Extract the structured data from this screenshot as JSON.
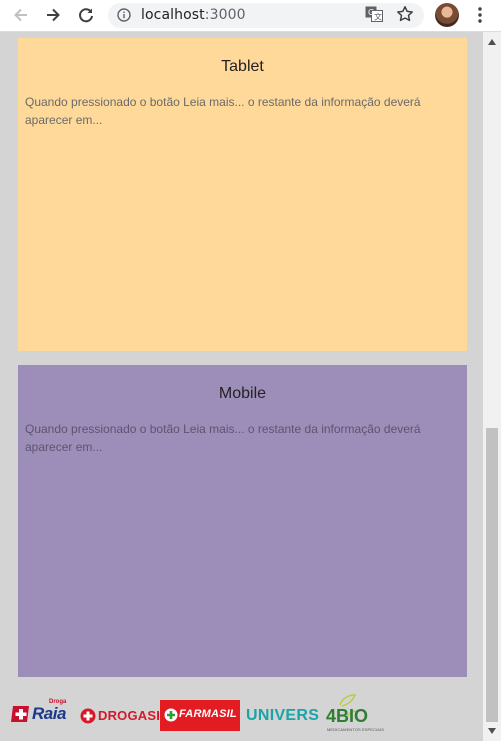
{
  "browser": {
    "url_host": "localhost",
    "url_port": ":3000"
  },
  "cards": [
    {
      "title": "Tablet",
      "text": "Quando pressionado o botão Leia mais... o restante da informação deverá aparecer em..."
    },
    {
      "title": "Mobile",
      "text": "Quando pressionado o botão Leia mais... o restante da informação deverá aparecer em..."
    }
  ],
  "brands": {
    "raia_small": "Droga",
    "raia": "Raia",
    "drogasil": "DROGASIL",
    "farmasil": "FARMASIL",
    "univers": "UNIVERS",
    "bio": "4BIO",
    "bio_sub": "MEDICAMENTOS ESPECIAIS"
  },
  "colors": {
    "tablet_card": "#ffd999",
    "mobile_card": "#9d8eb9",
    "page_background": "#d4d4d4"
  },
  "icons": [
    "back-arrow-icon",
    "forward-arrow-icon",
    "reload-icon",
    "info-icon",
    "translate-icon",
    "star-icon",
    "menu-icon"
  ]
}
